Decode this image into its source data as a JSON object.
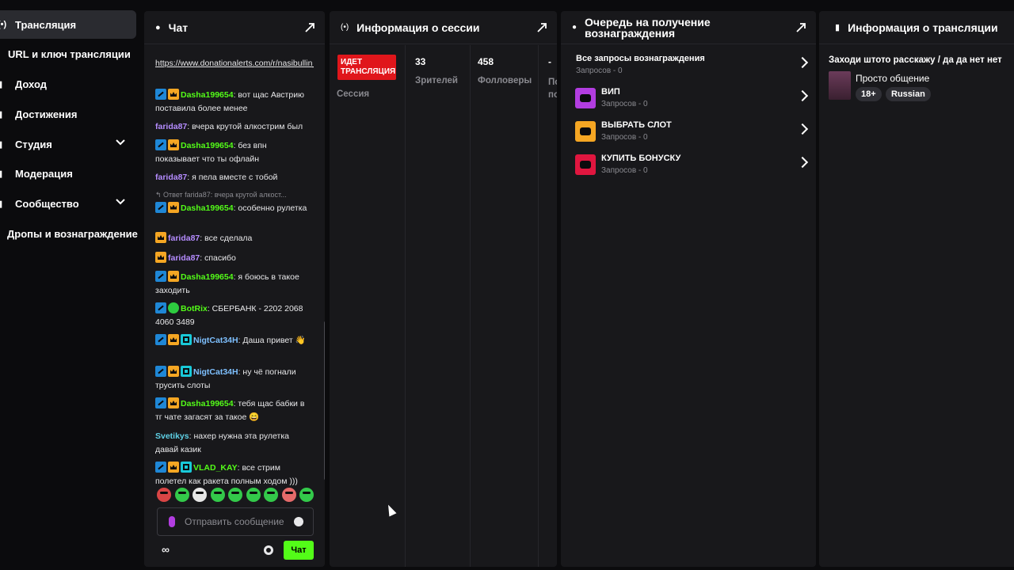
{
  "sidebar": {
    "items": [
      {
        "label": "Трансляция",
        "icon": "broadcast-icon",
        "active": true
      },
      {
        "label": "URL и ключ трансляции"
      },
      {
        "label": "Доход",
        "icon": "chart-icon"
      },
      {
        "label": "Достижения",
        "icon": "trophy-icon"
      },
      {
        "label": "Студия",
        "icon": "studio-icon",
        "expandable": true
      },
      {
        "label": "Модерация",
        "icon": "wrench-icon"
      },
      {
        "label": "Сообщество",
        "icon": "community-icon",
        "expandable": true
      },
      {
        "label": "Дропы и вознаграждение"
      }
    ]
  },
  "chat": {
    "title": "Чат",
    "messages": [
      {
        "text": "https://www.donationalerts.com/r/nasibullin_vitalik"
      },
      {
        "user": "Dasha199654",
        "text": ": вот щас Австрию поставила более менее"
      },
      {
        "user": "farida87",
        "text": ": вчера крутой алкострим был"
      },
      {
        "user": "Dasha199654",
        "text": ": без впн показывает что ты офлайн"
      },
      {
        "user": "farida87",
        "text": ": я пела вместе с тобой"
      },
      {
        "reply": "Ответ farida87: вчера крутой алкост...",
        "user": "Dasha199654",
        "text": ": особенно рулетка"
      },
      {
        "user": "farida87",
        "text": ": все сделала"
      },
      {
        "user": "farida87",
        "text": ": спасибо"
      },
      {
        "user": "Dasha199654",
        "text": ": я боюсь в такое заходить"
      },
      {
        "user": "BotRix",
        "text": ": СБЕРБАНК - 2202 2068 4060 3489"
      },
      {
        "user": "NigtCat34H",
        "text": ": Даша привет 👋"
      },
      {
        "user": "NigtCat34H",
        "text": ": ну чё погнали трусить слоты"
      },
      {
        "user": "Dasha199654",
        "text": ": тебя щас бабки в тг чате загасят за такое 😄"
      },
      {
        "user": "Svetikys",
        "text": ": нахер нужна эта рулетка давай казик"
      },
      {
        "user": "VLAD_KAY",
        "text": ": все стрим полетел как ракета полным ходом )))"
      }
    ],
    "input_placeholder": "Отправить сообщение",
    "send_label": "Чат",
    "infinity": "∞"
  },
  "session": {
    "title": "Информация о сессии",
    "live_label": "ИДЕТ ТРАНСЛЯЦИЯ",
    "session_label": "Сессия",
    "viewers": "33",
    "viewers_label": "Зрителей",
    "followers": "458",
    "followers_label": "Фолловеры",
    "extra_value": "-",
    "extra_label": "По по"
  },
  "rewards": {
    "title": "Очередь на получение вознаграждения",
    "all": {
      "name": "Все запросы вознаграждения",
      "sub": "Запросов - 0"
    },
    "items": [
      {
        "name": "ВИП",
        "sub": "Запросов - 0",
        "color": "#b23de0"
      },
      {
        "name": "ВЫБРАТЬ СЛОТ",
        "sub": "Запросов - 0",
        "color": "#f5a623"
      },
      {
        "name": "КУПИТЬ БОНУСКУ",
        "sub": "Запросов - 0",
        "color": "#e0163f"
      }
    ]
  },
  "stream_info": {
    "title": "Информация о трансляции",
    "stream_title": "Заходи штото расскажу / да да нет нет",
    "category": "Просто общение",
    "tags": [
      "18+",
      "Russian"
    ]
  },
  "colors": {
    "accent": "#53fc18",
    "live": "#e0161b",
    "panel": "#18181b"
  }
}
